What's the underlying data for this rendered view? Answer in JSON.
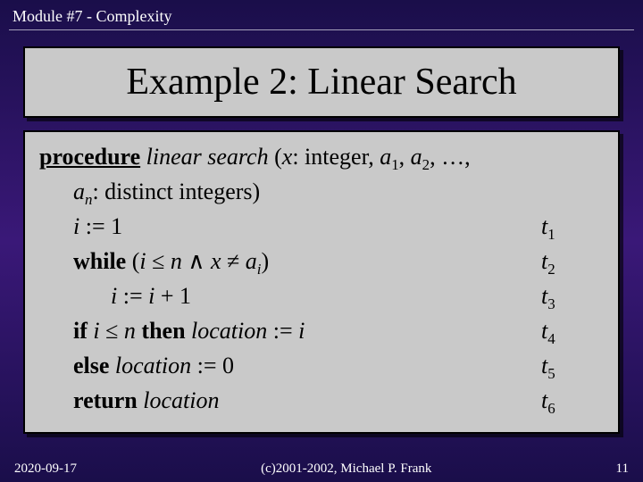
{
  "header": "Module #7 - Complexity",
  "title": "Example 2: Linear Search",
  "proc": {
    "kw_procedure": "procedure",
    "name": "linear search",
    "sig_open": " (",
    "x": "x",
    "sig_mid1": ": integer, ",
    "a": "a",
    "sig_mid2": ", ",
    "sig_mid3": ", …,",
    "sig_line2a": ": distinct integers)",
    "sub1": "1",
    "sub2": "2",
    "subn": "n",
    "subi": "i"
  },
  "lines": {
    "l1_left_a": "i",
    "l1_left_b": " := 1",
    "l1_t": "t",
    "l1_tn": "1",
    "l2_kw": "while",
    "l2_open": " (",
    "l2_i": "i",
    "l2_le": " ≤ ",
    "l2_n": "n",
    "l2_and": " ∧ ",
    "l2_x": "x",
    "l2_ne": " ≠ ",
    "l2_a": "a",
    "l2_close": ")",
    "l2_t": "t",
    "l2_tn": "2",
    "l3_i": "i",
    "l3_mid": " := ",
    "l3_i2": "i",
    "l3_plus": " + 1",
    "l3_t": "t",
    "l3_tn": "3",
    "l4_if": "if",
    "l4_i": " i",
    "l4_le": " ≤ ",
    "l4_n": "n",
    "l4_then": " then",
    "l4_loc": " location",
    "l4_assign": " := ",
    "l4_i2": "i",
    "l4_t": "t",
    "l4_tn": "4",
    "l5_else": "else",
    "l5_loc": " location",
    "l5_assign": " := 0",
    "l5_t": "t",
    "l5_tn": "5",
    "l6_ret": "return",
    "l6_loc": " location",
    "l6_t": "t",
    "l6_tn": "6"
  },
  "footer": {
    "left": "2020-09-17",
    "center": "(c)2001-2002, Michael P. Frank",
    "right": "11"
  }
}
